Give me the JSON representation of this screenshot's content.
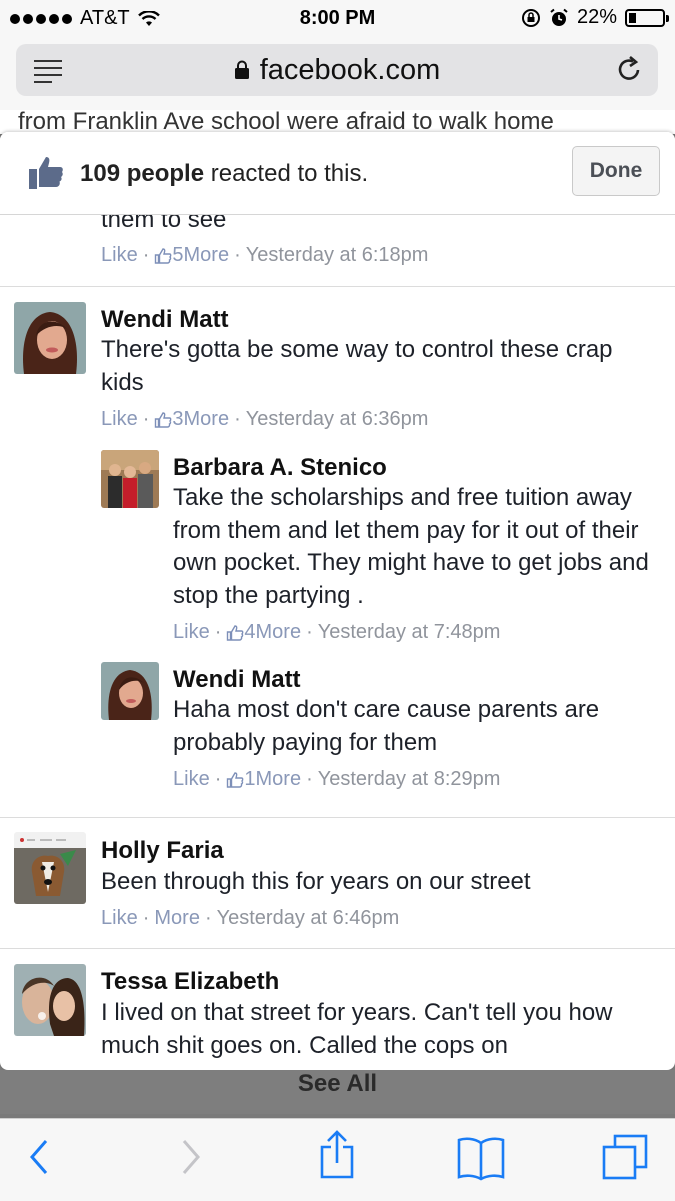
{
  "status": {
    "carrier": "AT&T",
    "time": "8:00 PM",
    "battery": "22%",
    "battery_level": 0.22
  },
  "browser": {
    "host": "facebook.com"
  },
  "background_text": "from Franklin Ave school were afraid to walk home",
  "reactions": {
    "count_text": "109 people",
    "suffix": "reacted to this.",
    "done_label": "Done"
  },
  "comments": [
    {
      "text_tail": "them to see",
      "like": "Like",
      "reactions": "5",
      "more": "More",
      "time": "Yesterday at 6:18pm"
    },
    {
      "name": "Wendi Matt",
      "text": "There's gotta be some way to control these crap kids",
      "like": "Like",
      "reactions": "3",
      "more": "More",
      "time": "Yesterday at 6:36pm"
    },
    {
      "name": "Barbara A. Stenico",
      "text": "Take the scholarships and free tuition away from them and let them pay for it out of their own pocket. They might have to get jobs and stop the partying .",
      "like": "Like",
      "reactions": "4",
      "more": "More",
      "time": "Yesterday at 7:48pm"
    },
    {
      "name": "Wendi Matt",
      "text": "Haha most don't care cause parents are probably paying for them",
      "like": "Like",
      "reactions": "1",
      "more": "More",
      "time": "Yesterday at 8:29pm"
    },
    {
      "name": "Holly Faria",
      "text": "Been through this for years on our street",
      "like": "Like",
      "more": "More",
      "time": "Yesterday at 6:46pm"
    },
    {
      "name": "Tessa Elizabeth",
      "text": "I lived on that street for years. Can't tell you how much shit goes on. Called the cops on"
    }
  ],
  "see_all": "See All"
}
